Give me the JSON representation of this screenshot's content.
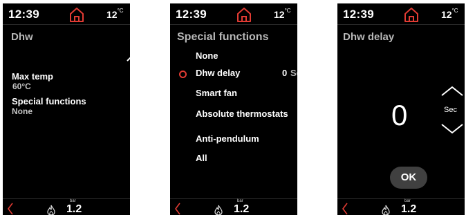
{
  "status": {
    "time": "12:39",
    "outdoor_temp": "12",
    "temp_unit": "°C"
  },
  "footer": {
    "pressure_unit": "bar",
    "pressure": "1.2"
  },
  "screen1": {
    "title": "Dhw",
    "fields": [
      {
        "label": "Max temp",
        "value": "60°C"
      },
      {
        "label": "Special functions",
        "value": "None"
      }
    ]
  },
  "screen2": {
    "title": "Special functions",
    "options": [
      {
        "label": "None"
      },
      {
        "label": "Dhw delay",
        "selected": true,
        "value": "0",
        "unit": "Sec"
      },
      {
        "label": "Smart fan"
      },
      {
        "label": "Absolute thermostats"
      },
      {
        "label": "Anti-pendulum"
      },
      {
        "label": "All"
      }
    ]
  },
  "screen3": {
    "title": "Dhw delay",
    "value": "0",
    "unit": "Sec",
    "ok_label": "OK"
  },
  "colors": {
    "accent": "#e23b33",
    "background": "#000000",
    "button": "#404040"
  }
}
